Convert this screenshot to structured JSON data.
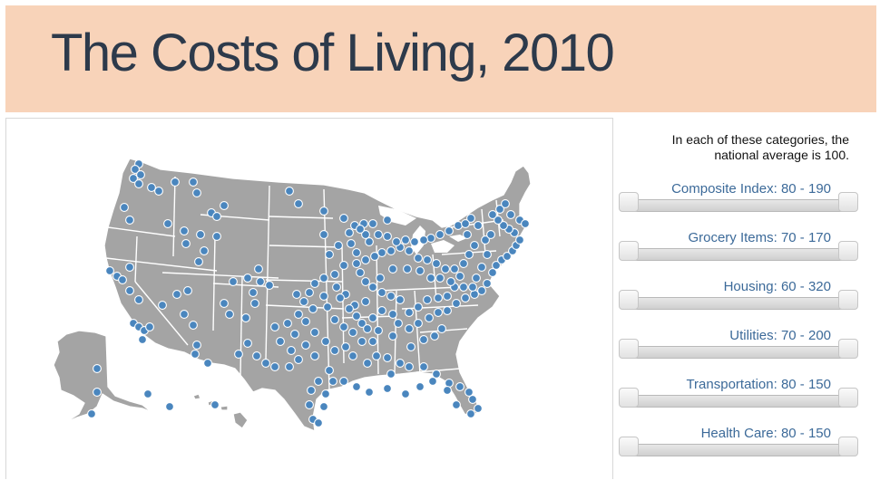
{
  "header": {
    "title": "The Costs of Living, 2010"
  },
  "sidebar": {
    "note": "In each of these categories, the national average is 100.",
    "filters": [
      {
        "label": "Composite Index: 80 - 190",
        "min": 80,
        "max": 190
      },
      {
        "label": "Grocery Items: 70 - 170",
        "min": 70,
        "max": 170
      },
      {
        "label": "Housing: 60 - 320",
        "min": 60,
        "max": 320
      },
      {
        "label": "Utilities: 70 - 200",
        "min": 70,
        "max": 200
      },
      {
        "label": "Transportation: 80 - 150",
        "min": 80,
        "max": 150
      },
      {
        "label": "Health Care: 80 - 150",
        "min": 80,
        "max": 150
      }
    ]
  },
  "colors": {
    "banner": "#f8d3b9",
    "title": "#2d3a4b",
    "land": "#a4a4a4",
    "city_marker": "#4a86be",
    "label": "#3c6a99"
  }
}
